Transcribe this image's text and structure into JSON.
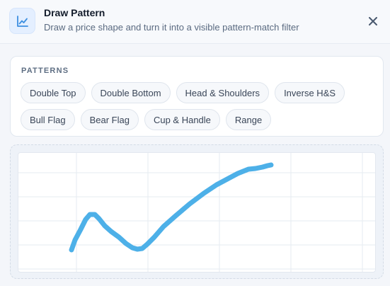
{
  "dialog": {
    "title": "Draw Pattern",
    "subtitle": "Draw a price shape and turn it into a visible pattern-match filter",
    "icon": "line-chart-icon",
    "close_icon": "close-icon"
  },
  "patterns": {
    "label": "PATTERNS",
    "items": [
      {
        "label": "Double Top"
      },
      {
        "label": "Double Bottom"
      },
      {
        "label": "Head & Shoulders"
      },
      {
        "label": "Inverse H&S"
      },
      {
        "label": "Bull Flag"
      },
      {
        "label": "Bear Flag"
      },
      {
        "label": "Cup & Handle"
      },
      {
        "label": "Range"
      }
    ]
  },
  "canvas": {
    "stroke_color": "#4db0e8",
    "grid_color": "#e6ebf1"
  }
}
